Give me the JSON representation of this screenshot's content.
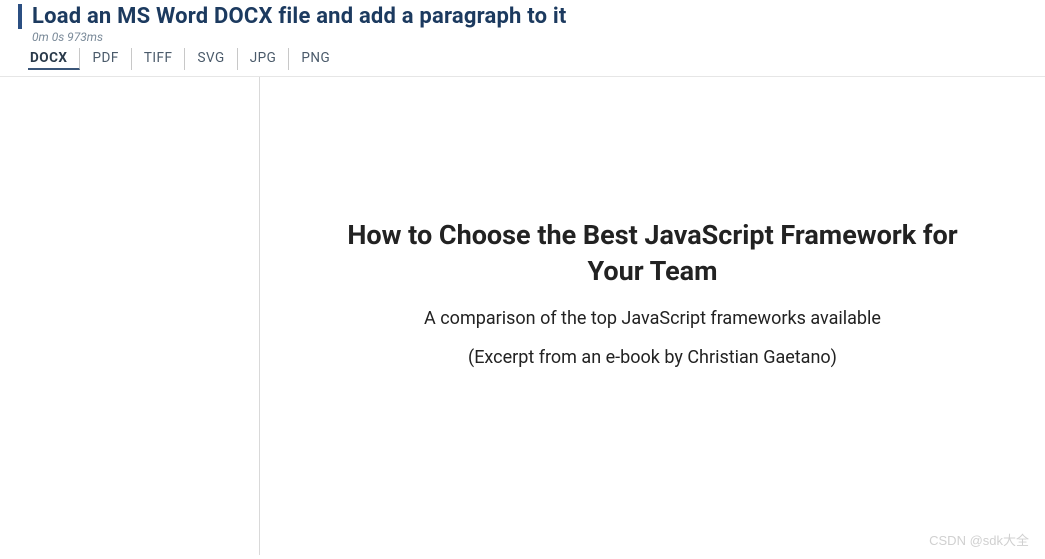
{
  "header": {
    "title": "Load an MS Word DOCX file and add a paragraph to it",
    "timing": "0m 0s 973ms"
  },
  "tabs": [
    {
      "label": "DOCX",
      "active": true
    },
    {
      "label": "PDF",
      "active": false
    },
    {
      "label": "TIFF",
      "active": false
    },
    {
      "label": "SVG",
      "active": false
    },
    {
      "label": "JPG",
      "active": false
    },
    {
      "label": "PNG",
      "active": false
    }
  ],
  "document": {
    "title": "How to Choose the Best JavaScript Framework for Your Team",
    "subtitle": "A comparison of the top JavaScript frameworks available",
    "excerpt": "(Excerpt from an e-book by Christian Gaetano)"
  },
  "watermark": "CSDN @sdk大全"
}
